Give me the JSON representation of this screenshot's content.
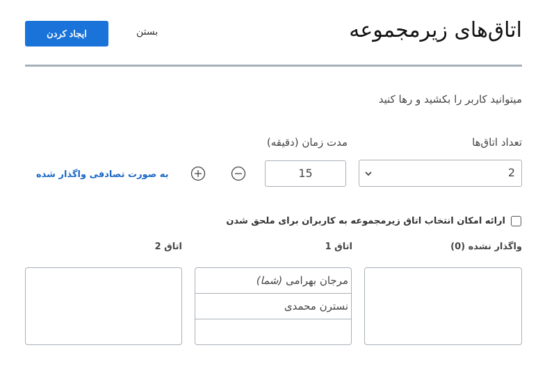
{
  "header": {
    "title": "اتاق‌های زیرمجموعه",
    "create_label": "ایجاد کردن",
    "close_label": "بستن",
    "accent_color": "#1a73d9"
  },
  "instructions": "میتوانید کاربر را بکشید و رها کنید",
  "settings": {
    "rooms_count_label": "تعداد اتاق‌ها",
    "rooms_count_value": "2",
    "duration_label": "مدت زمان (دقیقه)",
    "duration_value": "15",
    "random_assign_label": "به صورت تصادفی واگذار شده",
    "allow_choose_label": "ارائه امکان انتخاب اتاق زیرمجموعه به کاربران برای ملحق شدن",
    "allow_choose_checked": false
  },
  "columns": {
    "unassigned": {
      "title": "واگذار نشده (0)",
      "members": []
    },
    "room1": {
      "title": "اتاق 1",
      "members": [
        {
          "name": "مرجان بهرامی",
          "suffix": "(شما)"
        },
        {
          "name": "نسترن محمدی",
          "suffix": ""
        }
      ]
    },
    "room2": {
      "title": "اتاق 2",
      "members": []
    }
  }
}
